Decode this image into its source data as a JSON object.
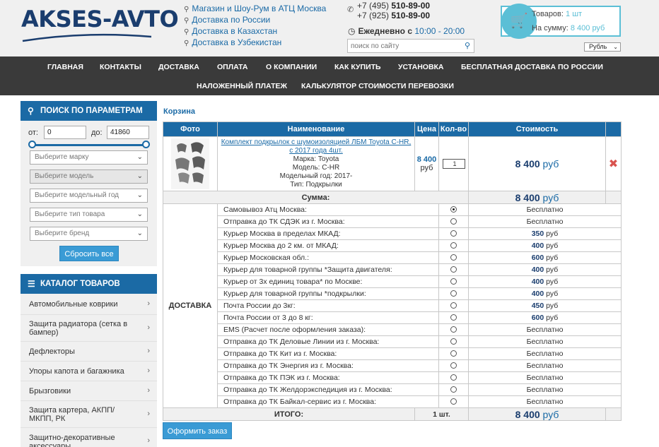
{
  "header": {
    "logo": "AKSES-AVTO",
    "locations": [
      "Магазин и Шоу-Рум в АТЦ Москва",
      "Доставка по России",
      "Доставка в Казахстан",
      "Доставка в Узбекистан"
    ],
    "phones": [
      {
        "prefix": "+7 (495) ",
        "number": "510-89-00"
      },
      {
        "prefix": "+7 (925) ",
        "number": "510-89-00"
      }
    ],
    "hours_label": "Ежедневно с ",
    "hours_time": "10:00 - 20:00",
    "search_placeholder": "поиск по сайту",
    "cart": {
      "goods_label": "Товаров: ",
      "goods_value": "1 шт",
      "sum_label": "На сумму: ",
      "sum_value": "8 400 руб"
    },
    "currency": "Рубль"
  },
  "nav": {
    "row1": [
      "ГЛАВНАЯ",
      "КОНТАКТЫ",
      "ДОСТАВКА",
      "ОПЛАТА",
      "О КОМПАНИИ",
      "КАК КУПИТЬ",
      "УСТАНОВКА",
      "БЕСПЛАТНАЯ ДОСТАВКА ПО РОССИИ"
    ],
    "row2": [
      "НАЛОЖЕННЫЙ ПЛАТЕЖ",
      "КАЛЬКУЛЯТОР СТОИМОСТИ ПЕРЕВОЗКИ"
    ]
  },
  "params": {
    "title": "ПОИСК ПО ПАРАМЕТРАМ",
    "from_label": "от:",
    "from_value": "0",
    "to_label": "до:",
    "to_value": "41860",
    "selects": [
      "Выберите марку",
      "Выберите модель",
      "Выберите модельный год",
      "Выберите тип товара",
      "Выберите бренд"
    ],
    "reset": "Сбросить все"
  },
  "catalog": {
    "title": "КАТАЛОГ ТОВАРОВ",
    "items": [
      "Автомобильные коврики",
      "Защита радиатора (сетка в бампер)",
      "Дефлекторы",
      "Упоры капота и багажника",
      "Брызговики",
      "Защита картера, АКПП/МКПП, РК",
      "Защитно-декоративные аксессуары"
    ]
  },
  "breadcrumb": "Корзина",
  "table": {
    "headers": [
      "Фото",
      "Наименование",
      "Цена",
      "Кол-во",
      "Стоимость"
    ],
    "product": {
      "name": "Комплект подкрылок с шумоизоляцией ЛБМ Toyota C-HR, с 2017 года 4шт.",
      "attrs": [
        {
          "k": "Марка:",
          "v": "Toyota"
        },
        {
          "k": "Модель:",
          "v": "C-HR"
        },
        {
          "k": "Модельный год:",
          "v": "2017-"
        },
        {
          "k": "Тип:",
          "v": "Подкрылки"
        }
      ],
      "price_value": "8 400",
      "price_unit": "руб",
      "qty": "1",
      "cost_value": "8 400",
      "cost_unit": " руб"
    },
    "sum_label": "Сумма:",
    "sum_value": "8 400",
    "sum_unit": " руб",
    "delivery_label": "ДОСТАВКА",
    "delivery": [
      {
        "name": "Самовывоз Атц Москва:",
        "selected": true,
        "price": "Бесплатно"
      },
      {
        "name": "Отправка до ТК СДЭК из г. Москва:",
        "selected": false,
        "price": "Бесплатно"
      },
      {
        "name": "Курьер Москва в пределах МКАД:",
        "selected": false,
        "num": "350",
        "unit": " руб"
      },
      {
        "name": "Курьер Москва до 2 км. от МКАД:",
        "selected": false,
        "num": "400",
        "unit": " руб"
      },
      {
        "name": "Курьер Московская обл.:",
        "selected": false,
        "num": "600",
        "unit": " руб"
      },
      {
        "name": "Курьер для товарной группы *Защита двигателя:",
        "selected": false,
        "num": "400",
        "unit": " руб"
      },
      {
        "name": "Курьер от 3х единиц товара* по Москве:",
        "selected": false,
        "num": "400",
        "unit": " руб"
      },
      {
        "name": "Курьер для товарной группы *подкрылки:",
        "selected": false,
        "num": "400",
        "unit": " руб"
      },
      {
        "name": "Почта России до 3кг:",
        "selected": false,
        "num": "450",
        "unit": " руб"
      },
      {
        "name": "Почта России от 3 до 8 кг:",
        "selected": false,
        "num": "600",
        "unit": " руб"
      },
      {
        "name": "EMS (Расчет после оформления заказа):",
        "selected": false,
        "price": "Бесплатно"
      },
      {
        "name": "Отправка до ТК Деловые Линии из г. Москва:",
        "selected": false,
        "price": "Бесплатно"
      },
      {
        "name": "Отправка до ТК Кит из г. Москва:",
        "selected": false,
        "price": "Бесплатно"
      },
      {
        "name": "Отправка до ТК Энергия из г. Москва:",
        "selected": false,
        "price": "Бесплатно"
      },
      {
        "name": "Отправка до ТК ПЭК из г. Москва:",
        "selected": false,
        "price": "Бесплатно"
      },
      {
        "name": "Отправка до ТК Желдорэкспедиция из г. Москва:",
        "selected": false,
        "price": "Бесплатно"
      },
      {
        "name": "Отправка до ТК Байкал-сервис из г. Москва:",
        "selected": false,
        "price": "Бесплатно"
      }
    ],
    "total_label": "ИТОГО:",
    "total_qty": "1 шт.",
    "total_value": "8 400",
    "total_unit": " руб"
  },
  "order_button": "Оформить заказ",
  "colors": {
    "brand": "#1b6aa5",
    "nav_bg": "#3a3a3a",
    "cart_accent": "#5bbfd6",
    "button": "#3a9bd5"
  },
  "icons": [
    "map-pin-icon",
    "phone-icon",
    "clock-icon",
    "search-icon",
    "shopping-cart-icon",
    "hamburger-icon",
    "chevron-right-icon",
    "delete-x-icon"
  ]
}
